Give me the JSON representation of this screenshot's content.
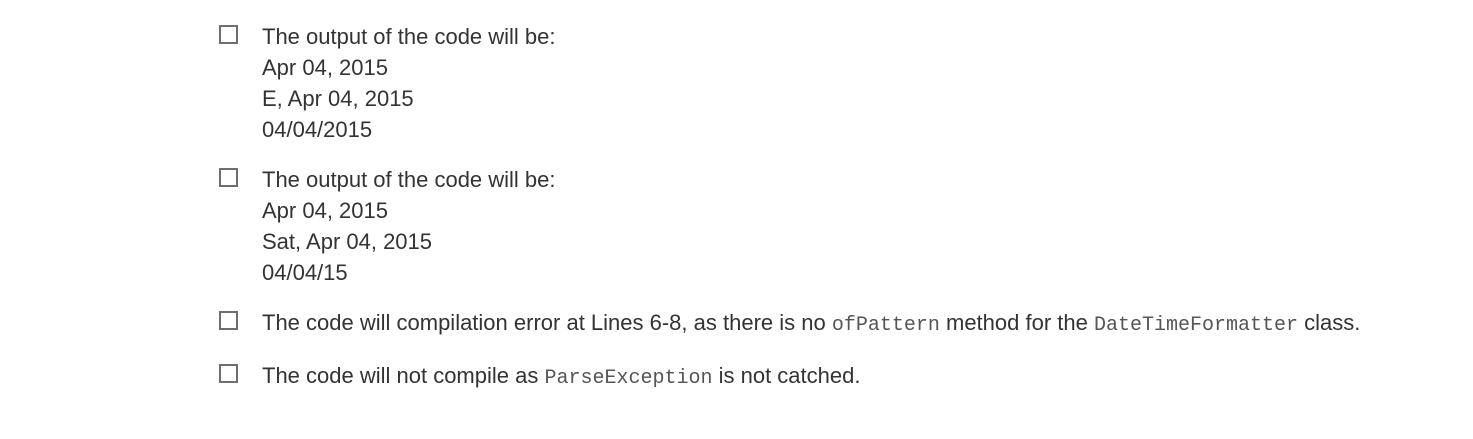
{
  "options": [
    {
      "lines": [
        "The output of the code will be:",
        "Apr 04, 2015",
        "E, Apr 04, 2015",
        "04/04/2015"
      ]
    },
    {
      "lines": [
        "The output of the code will be:",
        "Apr 04, 2015",
        "Sat, Apr 04, 2015",
        "04/04/15"
      ]
    },
    {
      "text_before": "The code will compilation error at Lines 6-8, as there is no ",
      "code1": "ofPattern",
      "text_middle": " method for the ",
      "code2": "DateTimeFormatter",
      "text_after": " class."
    },
    {
      "text_before": "The code will not compile as ",
      "code1": "ParseException",
      "text_after": " is not catched."
    }
  ]
}
